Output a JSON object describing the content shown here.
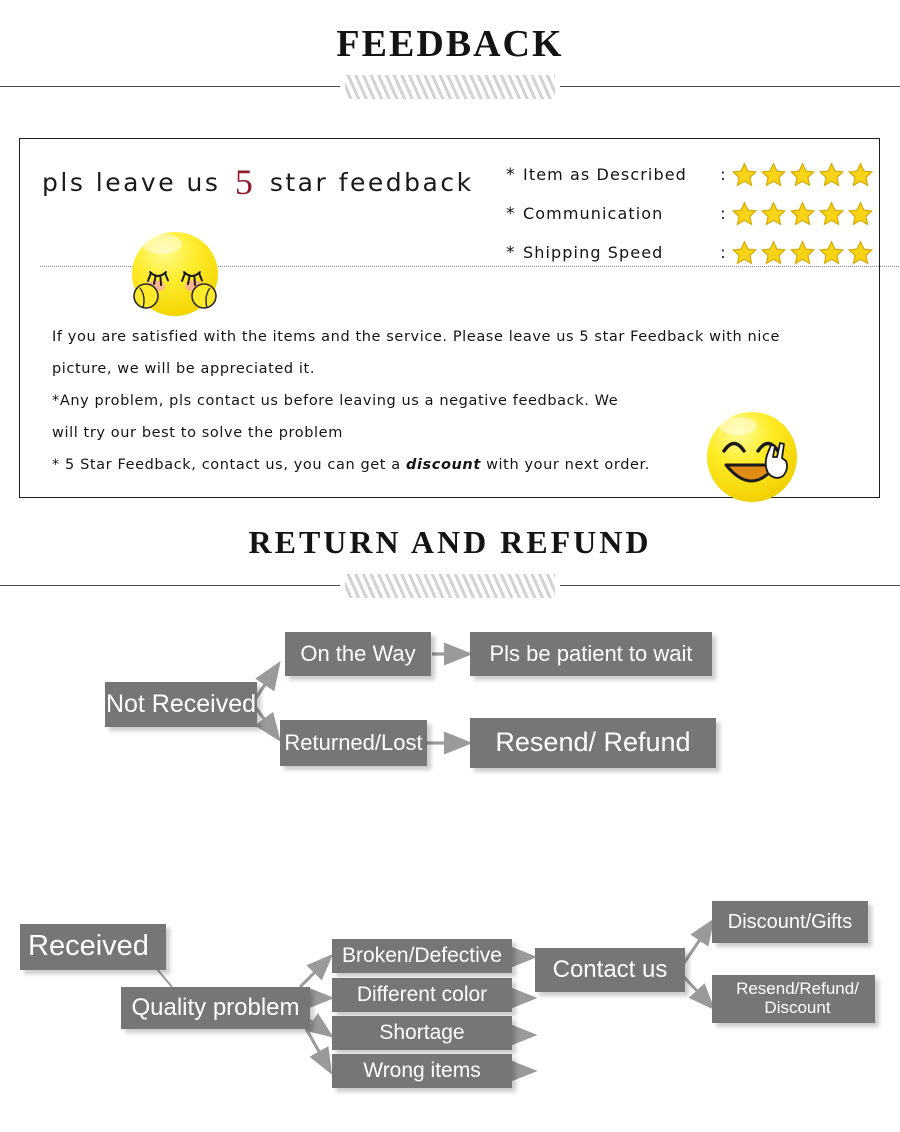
{
  "sections": {
    "feedback_title": "FEEDBACK",
    "return_title": "RETURN  AND  REFUND"
  },
  "feedback_panel": {
    "headline_before": "pls leave us",
    "headline_star_number": "5",
    "headline_after": "star feedback",
    "ratings": [
      {
        "bullet": "*",
        "label": "Item as Described",
        "colon": ":",
        "stars": 5
      },
      {
        "bullet": "*",
        "label": "Communication",
        "colon": ":",
        "stars": 5
      },
      {
        "bullet": "*",
        "label": "Shipping Speed",
        "colon": ":",
        "stars": 5
      }
    ],
    "body": {
      "line1": "If you are satisfied with the items and the service. Please leave us 5 star Feedback with nice",
      "line2": "picture, we will be appreciated it.",
      "line3": "*Any problem, pls contact us before leaving us a negative feedback. We",
      "line4": "will try our best to solve  the problem",
      "line5_a": "* 5 Star Feedback, contact us, you can get a ",
      "line5_italic": "discount",
      "line5_b": " with your next order."
    }
  },
  "flow_not_received": {
    "nodes": [
      {
        "id": "not-received",
        "label": "Not Received"
      },
      {
        "id": "on-the-way",
        "label": "On the Way"
      },
      {
        "id": "patient-wait",
        "label": "Pls be patient to wait"
      },
      {
        "id": "returned-lost",
        "label": "Returned/Lost"
      },
      {
        "id": "resend-refund",
        "label": "Resend/ Refund"
      }
    ]
  },
  "flow_received": {
    "nodes": [
      {
        "id": "received",
        "label": "Received"
      },
      {
        "id": "quality-problem",
        "label": "Quality problem"
      },
      {
        "id": "broken-defective",
        "label": "Broken/Defective"
      },
      {
        "id": "different-color",
        "label": "Different color"
      },
      {
        "id": "shortage",
        "label": "Shortage"
      },
      {
        "id": "wrong-items",
        "label": "Wrong items"
      },
      {
        "id": "contact-us",
        "label": "Contact us"
      },
      {
        "id": "discount-gifts",
        "label": "Discount/Gifts"
      },
      {
        "id": "resend-refund-discount_l1",
        "label": "Resend/Refund/"
      },
      {
        "id": "resend-refund-discount_l2",
        "label": "Discount"
      }
    ]
  },
  "colors": {
    "node_fill": "#767676",
    "node_text": "#ffffff",
    "arrow": "#9a9a9a",
    "star": "#f7d417",
    "star_outline": "#d8a800",
    "accent_red": "#8f1d2a",
    "panel_border": "#1d1d1d"
  },
  "icons": {
    "star": "star-icon",
    "emoji_shy": "shy-face-emoji-icon",
    "emoji_peace": "peace-sign-smiley-emoji-icon"
  }
}
